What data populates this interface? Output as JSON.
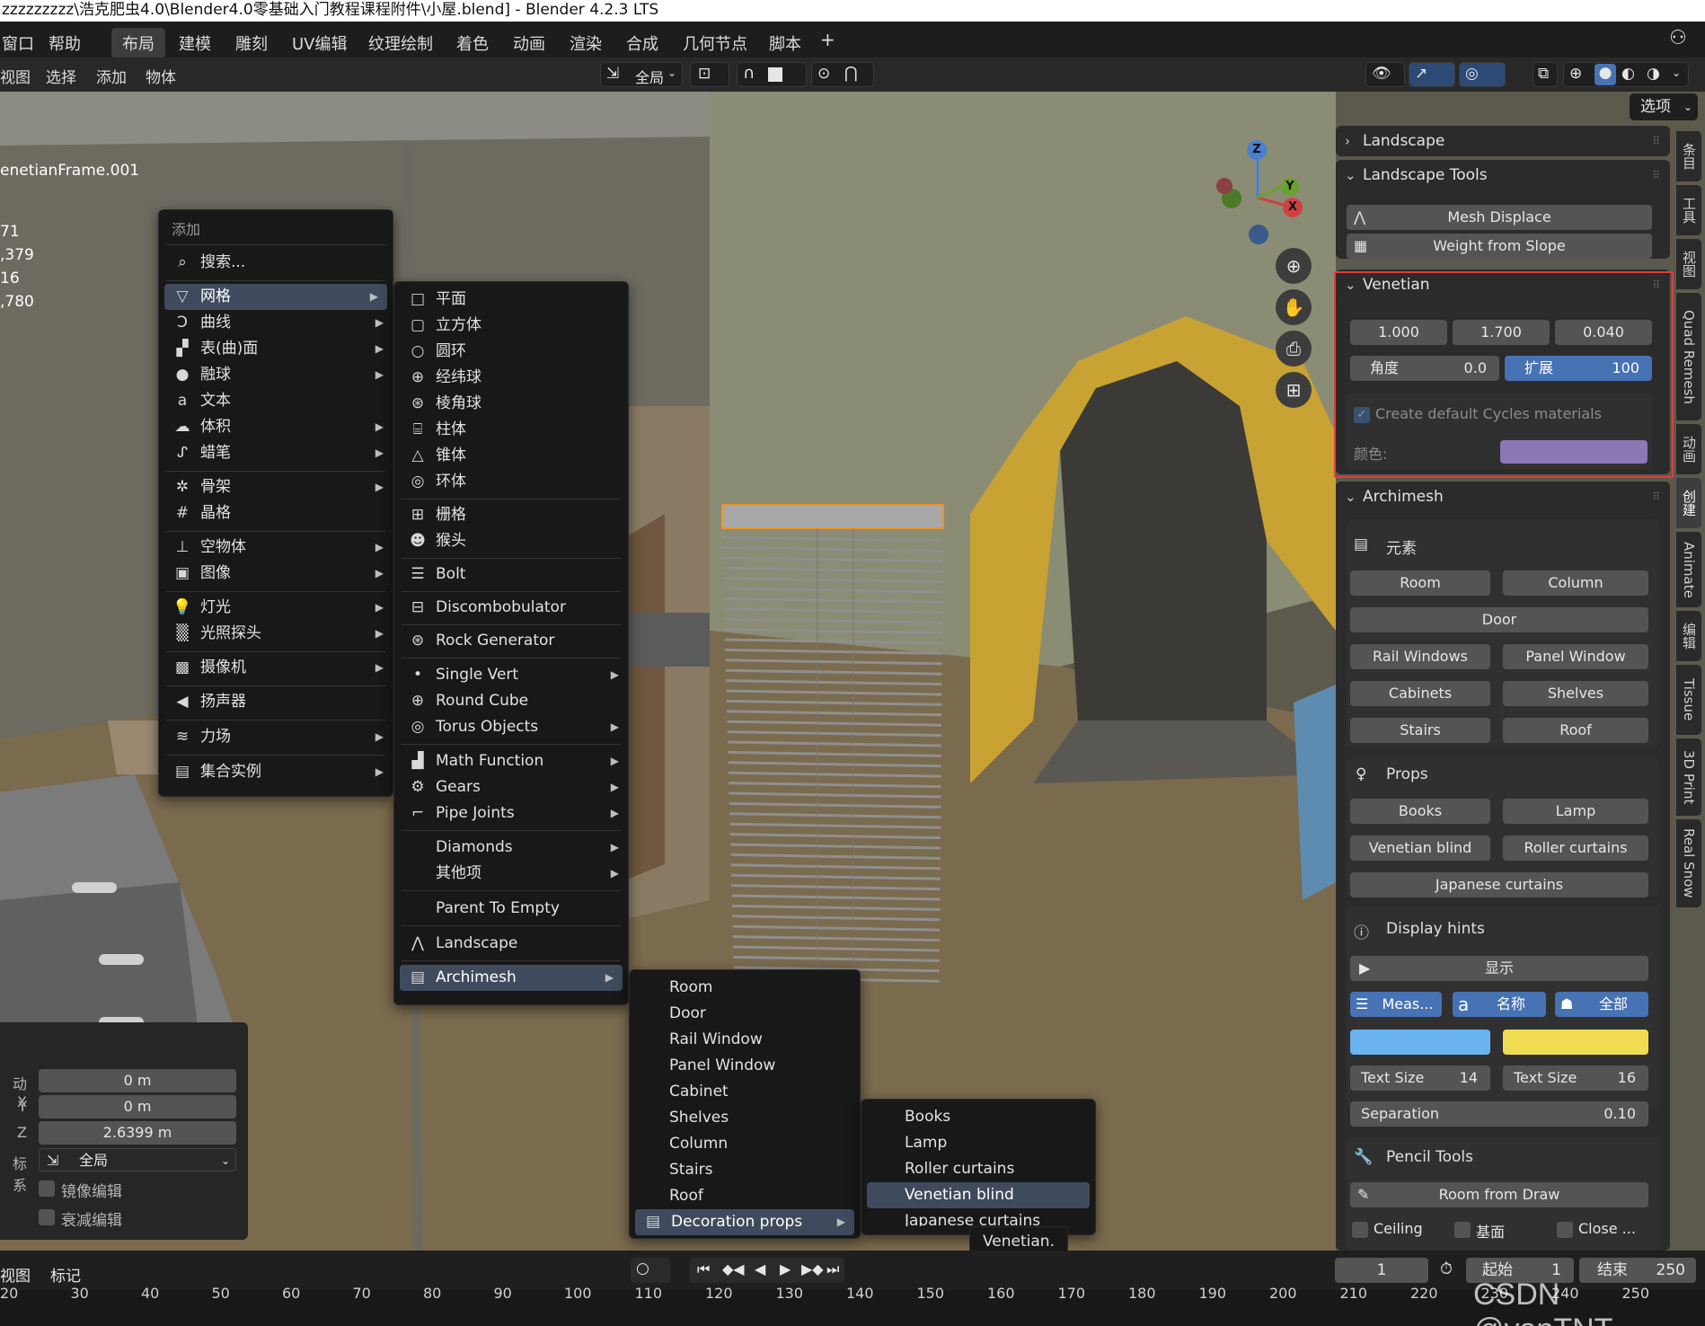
{
  "title": "zzzzzzzzz\\浩克肥虫4.0\\Blender4.0零基础入门教程课程附件\\小屋.blend] - Blender 4.2.3 LTS",
  "topmenu": {
    "window": "窗口",
    "help": "帮助"
  },
  "workspaces": [
    "布局",
    "建模",
    "雕刻",
    "UV编辑",
    "纹理绘制",
    "着色",
    "动画",
    "渲染",
    "合成",
    "几何节点",
    "脚本",
    "+"
  ],
  "header": {
    "view": "视图",
    "select": "选择",
    "add": "添加",
    "object": "物体",
    "transform": "全局",
    "options": "选项"
  },
  "overlay_text": {
    "object_name": "enetianFrame.001",
    "stat1": "71",
    "stat2": ",379",
    "stat3": "16",
    "stat4": ",780"
  },
  "add_menu": {
    "title": "添加",
    "search": "搜索...",
    "items": [
      {
        "icon": "▽",
        "label": "网格"
      },
      {
        "icon": "Ↄ",
        "label": "曲线"
      },
      {
        "icon": "▞",
        "label": "表(曲)面"
      },
      {
        "icon": "●",
        "label": "融球"
      },
      {
        "icon": "a",
        "label": "文本"
      },
      {
        "icon": "☁",
        "label": "体积"
      },
      {
        "icon": "ᔑ",
        "label": "蜡笔"
      },
      {
        "icon": "✲",
        "label": "骨架"
      },
      {
        "icon": "#",
        "label": "晶格"
      },
      {
        "icon": "⊥",
        "label": "空物体"
      },
      {
        "icon": "▣",
        "label": "图像"
      },
      {
        "icon": "💡",
        "label": "灯光"
      },
      {
        "icon": "▒",
        "label": "光照探头"
      },
      {
        "icon": "▩",
        "label": "摄像机"
      },
      {
        "icon": "◀",
        "label": "扬声器"
      },
      {
        "icon": "≋",
        "label": "力场"
      },
      {
        "icon": "▤",
        "label": "集合实例"
      }
    ]
  },
  "mesh_menu": {
    "items": [
      {
        "icon": "□",
        "label": "平面"
      },
      {
        "icon": "▢",
        "label": "立方体"
      },
      {
        "icon": "○",
        "label": "圆环"
      },
      {
        "icon": "⊕",
        "label": "经纬球"
      },
      {
        "icon": "⊛",
        "label": "棱角球"
      },
      {
        "icon": "⌸",
        "label": "柱体"
      },
      {
        "icon": "△",
        "label": "锥体"
      },
      {
        "icon": "◎",
        "label": "环体"
      },
      {
        "icon": "⊞",
        "label": "栅格"
      },
      {
        "icon": "☻",
        "label": "猴头"
      },
      {
        "icon": "☰",
        "label": "Bolt"
      },
      {
        "icon": "⊟",
        "label": "Discombobulator"
      },
      {
        "icon": "⊛",
        "label": "Rock Generator"
      },
      {
        "icon": "•",
        "label": "Single Vert"
      },
      {
        "icon": "⊕",
        "label": "Round Cube"
      },
      {
        "icon": "◎",
        "label": "Torus Objects"
      },
      {
        "icon": "▟",
        "label": "Math Function"
      },
      {
        "icon": "⚙",
        "label": "Gears"
      },
      {
        "icon": "⌐",
        "label": "Pipe Joints"
      },
      {
        "icon": "",
        "label": "Diamonds"
      },
      {
        "icon": "",
        "label": "其他项"
      },
      {
        "icon": "",
        "label": "Parent To Empty"
      },
      {
        "icon": "⋀",
        "label": "Landscape"
      },
      {
        "icon": "▤",
        "label": "Archimesh"
      }
    ]
  },
  "archimesh_menu": {
    "items": [
      "Room",
      "Door",
      "Rail Window",
      "Panel Window",
      "Cabinet",
      "Shelves",
      "Column",
      "Stairs",
      "Roof"
    ],
    "deco": "Decoration props"
  },
  "deco_menu": {
    "items": [
      "Books",
      "Lamp",
      "Roller curtains",
      "Venetian blind",
      "Japanese curtains"
    ],
    "tooltip": "Venetian."
  },
  "npanel": {
    "landscape": "Landscape",
    "landscape_tools": "Landscape Tools",
    "mesh_displace": "Mesh Displace",
    "weight_from_slope": "Weight from Slope",
    "venetian": "Venetian",
    "v1": "1.000",
    "v2": "1.700",
    "v3": "0.040",
    "angle_label": "角度",
    "angle_val": "0.0",
    "expand_label": "扩展",
    "expand_val": "100",
    "cycles": "Create default Cycles materials",
    "color_label": "颜色:",
    "color_swatch": "#8b78b5",
    "archimesh": "Archimesh",
    "elements": "元素",
    "room": "Room",
    "column": "Column",
    "door": "Door",
    "rail_windows": "Rail Windows",
    "panel_window": "Panel Window",
    "cabinets": "Cabinets",
    "shelves": "Shelves",
    "stairs": "Stairs",
    "roof": "Roof",
    "props": "Props",
    "books": "Books",
    "lamp": "Lamp",
    "venetian_blind": "Venetian blind",
    "roller_curtains": "Roller curtains",
    "japanese_curtains": "Japanese curtains",
    "display_hints": "Display hints",
    "show": "显示",
    "meas": "Meas...",
    "name": "名称",
    "all": "全部",
    "text_size_label": "Text Size",
    "ts1": "14",
    "ts2": "16",
    "separation": "Separation",
    "sep_val": "0.10",
    "pencil_tools": "Pencil Tools",
    "room_from_draw": "Room from Draw",
    "ceiling": "Ceiling",
    "base": "基面",
    "close": "Close ..."
  },
  "sidetabs": [
    "条目",
    "工具",
    "视图",
    "Quad Remesh",
    "动画",
    "创建",
    "Animate",
    "编辑",
    "Tissue",
    "3D Print",
    "Real Snow"
  ],
  "op_panel": {
    "x_label": "动 X",
    "x": "0 m",
    "y_label": "Y",
    "y": "0 m",
    "z_label": "Z",
    "z": "2.6399 m",
    "sys_label": "标系",
    "sys": "全局",
    "mirror": "镜像编辑",
    "falloff": "衰减编辑"
  },
  "timeline": {
    "view": "视图",
    "marker": "标记",
    "frame": "1",
    "start_label": "起始",
    "start": "1",
    "end_label": "结束",
    "end": "250",
    "ticks": [
      "20",
      "30",
      "40",
      "50",
      "60",
      "70",
      "80",
      "90",
      "100",
      "110",
      "120",
      "130",
      "140",
      "150",
      "160",
      "170",
      "180",
      "190",
      "200",
      "210",
      "220",
      "230",
      "240",
      "250"
    ],
    "watermark": "CSDN @vanTNT"
  },
  "gizmo": {
    "z": "Z",
    "y": "Y",
    "x": "X"
  }
}
